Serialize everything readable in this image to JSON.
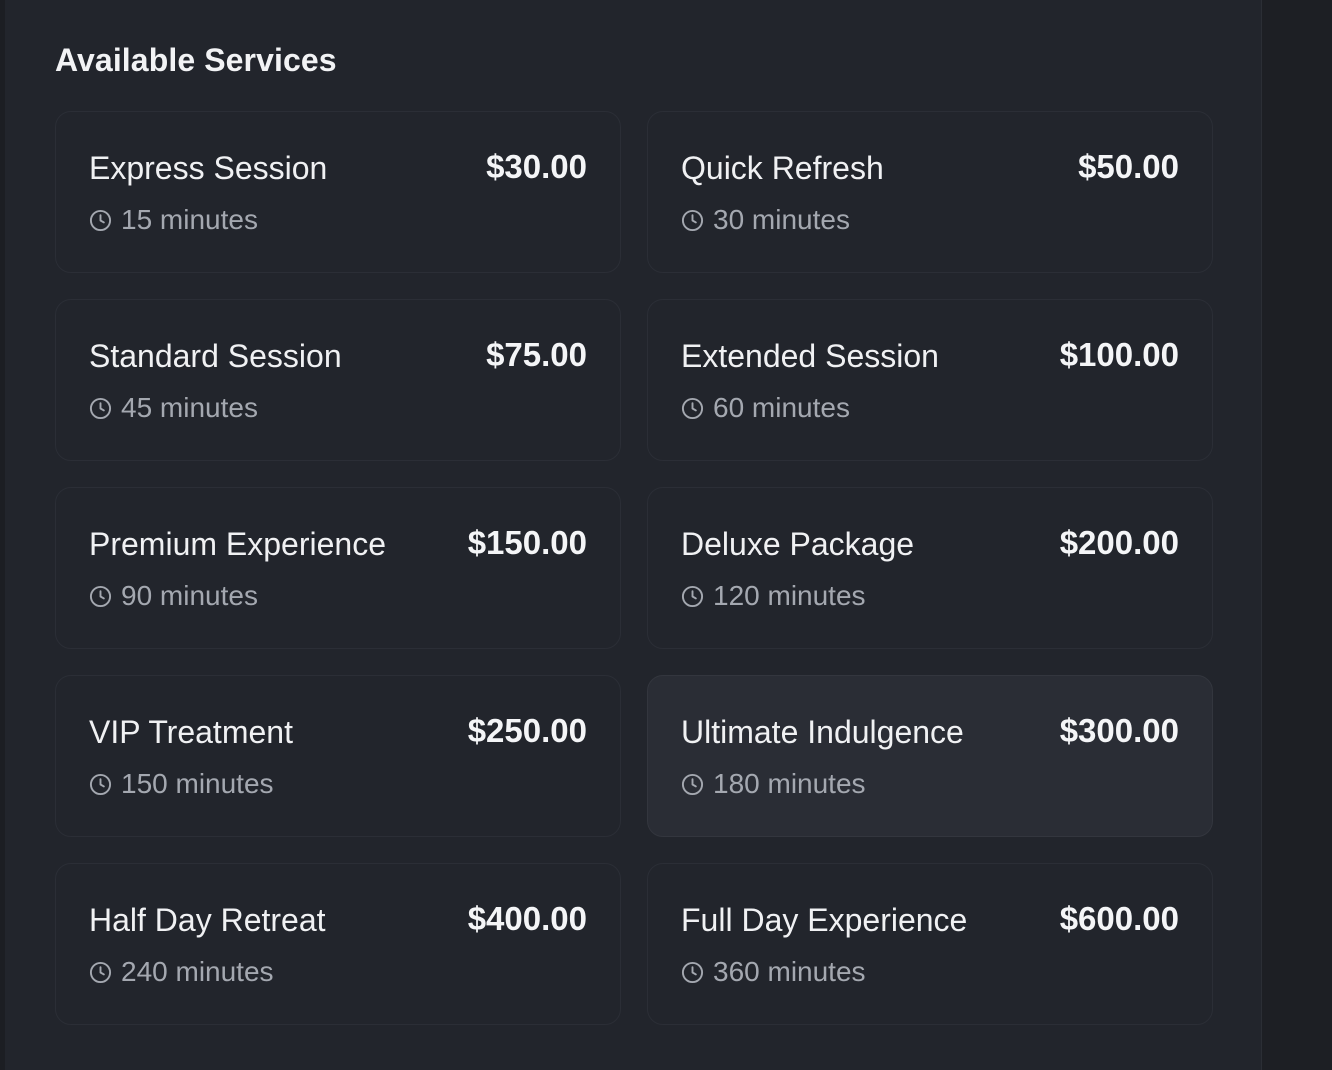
{
  "section": {
    "title": "Available Services"
  },
  "services": [
    {
      "name": "Express Session",
      "price": "$30.00",
      "duration": "15 minutes"
    },
    {
      "name": "Quick Refresh",
      "price": "$50.00",
      "duration": "30 minutes"
    },
    {
      "name": "Standard Session",
      "price": "$75.00",
      "duration": "45 minutes"
    },
    {
      "name": "Extended Session",
      "price": "$100.00",
      "duration": "60 minutes"
    },
    {
      "name": "Premium Experience",
      "price": "$150.00",
      "duration": "90 minutes"
    },
    {
      "name": "Deluxe Package",
      "price": "$200.00",
      "duration": "120 minutes"
    },
    {
      "name": "VIP Treatment",
      "price": "$250.00",
      "duration": "150 minutes"
    },
    {
      "name": "Ultimate Indulgence",
      "price": "$300.00",
      "duration": "180 minutes"
    },
    {
      "name": "Half Day Retreat",
      "price": "$400.00",
      "duration": "240 minutes"
    },
    {
      "name": "Full Day Experience",
      "price": "$600.00",
      "duration": "360 minutes"
    }
  ],
  "icons": {
    "duration": "clock-icon"
  },
  "colors": {
    "background": "#22252c",
    "card_border": "#2b2e36",
    "card_hover": "#2a2d35",
    "text_primary": "#f0f1f3",
    "text_secondary": "#a4a8b0"
  }
}
